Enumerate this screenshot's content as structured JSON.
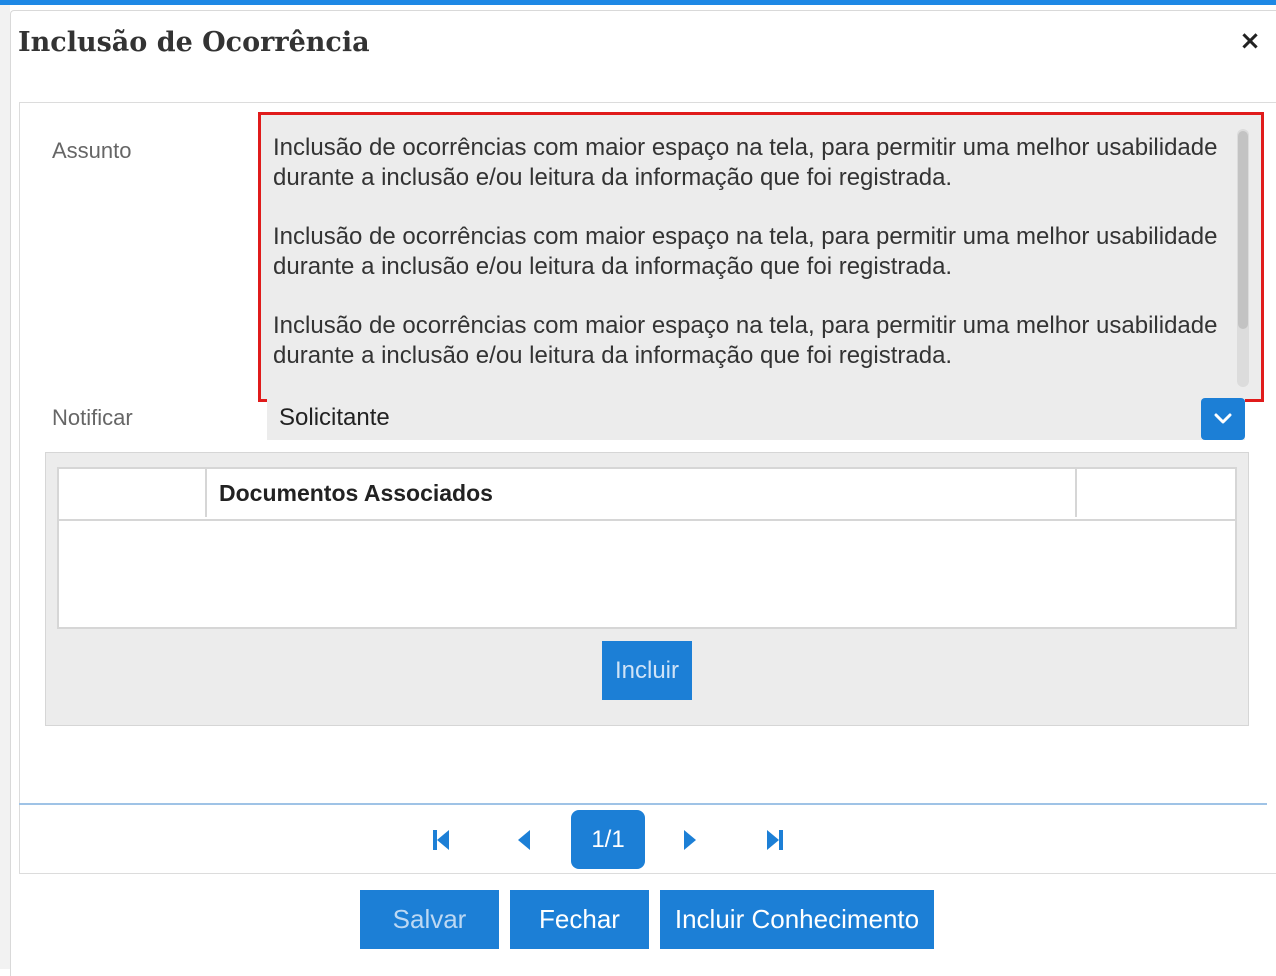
{
  "dialog": {
    "title": "Inclusão de Ocorrência",
    "close_label": "×"
  },
  "form": {
    "assunto_label": "Assunto",
    "assunto_paragraphs": [
      "Inclusão de ocorrências com maior espaço na tela, para permitir uma melhor usabilidade durante a inclusão e/ou leitura da informação que foi registrada.",
      "Inclusão de ocorrências com maior espaço na tela, para permitir uma melhor usabilidade durante a inclusão e/ou leitura da informação que foi registrada.",
      "Inclusão de ocorrências com maior espaço na tela, para permitir uma melhor usabilidade durante a inclusão e/ou leitura da informação que foi registrada."
    ],
    "notificar_label": "Notificar",
    "notificar_value": "Solicitante"
  },
  "documents": {
    "column_header": "Documentos Associados",
    "incluir_label": "Incluir"
  },
  "pager": {
    "current": "1/1",
    "icons": [
      "first-page-icon",
      "prev-page-icon",
      "next-page-icon",
      "last-page-icon"
    ]
  },
  "footer": {
    "salvar_label": "Salvar",
    "fechar_label": "Fechar",
    "incluir_conhecimento_label": "Incluir Conhecimento"
  },
  "colors": {
    "accent": "#1c7fd6",
    "highlight_border": "#e01b1b",
    "field_background": "#ececec"
  }
}
